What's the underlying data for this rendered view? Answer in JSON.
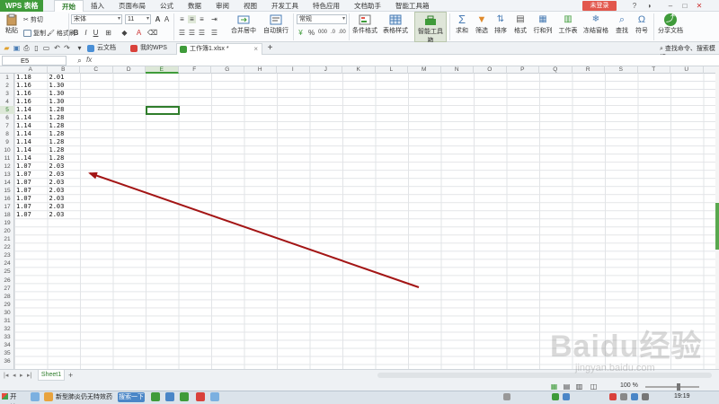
{
  "app": {
    "brand": "WPS 表格"
  },
  "menu": {
    "tabs": [
      "开始",
      "插入",
      "页面布局",
      "公式",
      "数据",
      "审阅",
      "视图",
      "开发工具",
      "特色应用",
      "文档助手",
      "智能工具箱"
    ],
    "active_index": 0,
    "login": "未登录"
  },
  "ribbon": {
    "paste": "粘贴",
    "cut": "剪切",
    "copy": "复制",
    "format_painter": "格式刷",
    "font_name": "宋体",
    "font_size": "11",
    "merge_center": "合并居中",
    "wrap_text": "自动换行",
    "number_format": "常规",
    "conditional_format": "条件格式",
    "table_style": "表格样式",
    "smart_toolbox": "智能工具箱",
    "sum": "求和",
    "filter": "筛选",
    "sort": "排序",
    "format": "格式",
    "row_col": "行和列",
    "worksheet": "工作表",
    "freeze": "冻结窗格",
    "find": "查找",
    "symbol": "符号",
    "share": "分享文档"
  },
  "doc_tabs": [
    {
      "label": "云文档",
      "icon": "cloud-icon",
      "color": "#4a8fd6"
    },
    {
      "label": "我的WPS",
      "icon": "wps-icon",
      "color": "#d9413b"
    },
    {
      "label": "工作簿1.xlsx *",
      "icon": "sheet-file-icon",
      "color": "#3f9b3a"
    }
  ],
  "right_command": "查找命令、搜索模板",
  "formula_bar": {
    "cell_ref": "E5",
    "fx": "fx",
    "value": ""
  },
  "columns": [
    "A",
    "B",
    "C",
    "D",
    "E",
    "F",
    "G",
    "H",
    "I",
    "J",
    "K",
    "L",
    "M",
    "N",
    "O",
    "P",
    "Q",
    "R",
    "S",
    "T",
    "U"
  ],
  "selected_column": "E",
  "selected_row": 5,
  "row_count": 36,
  "data_rows": [
    [
      "1.18",
      "2.01"
    ],
    [
      "1.16",
      "1.30"
    ],
    [
      "1.16",
      "1.30"
    ],
    [
      "1.16",
      "1.30"
    ],
    [
      "1.14",
      "1.28"
    ],
    [
      "1.14",
      "1.28"
    ],
    [
      "1.14",
      "1.28"
    ],
    [
      "1.14",
      "1.28"
    ],
    [
      "1.14",
      "1.28"
    ],
    [
      "1.14",
      "1.28"
    ],
    [
      "1.14",
      "1.28"
    ],
    [
      "1.07",
      "2.03"
    ],
    [
      "1.07",
      "2.03"
    ],
    [
      "1.07",
      "2.03"
    ],
    [
      "1.07",
      "2.03"
    ],
    [
      "1.07",
      "2.03"
    ],
    [
      "1.07",
      "2.03"
    ],
    [
      "1.07",
      "2.03"
    ]
  ],
  "sheet_tab": "Sheet1",
  "zoom": "100 %",
  "taskbar": {
    "start": "开始",
    "task": "新型肺炎仍无特效药",
    "search": "搜索一下",
    "clock": "19:19"
  },
  "watermark": "Baidu经验",
  "watermark_sub": "jingyan.baidu.com",
  "colors": {
    "accent": "#3f9b3a",
    "arrow": "#a31515",
    "login": "#e2574c"
  }
}
